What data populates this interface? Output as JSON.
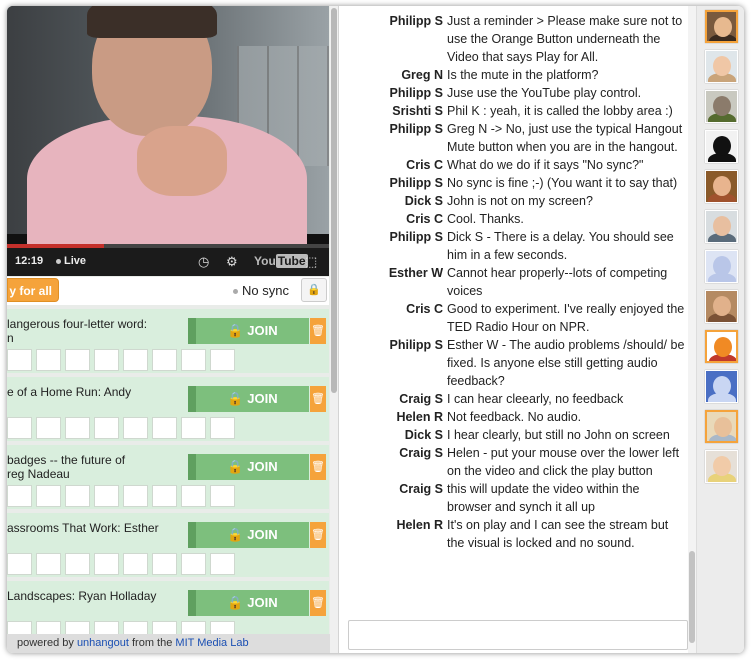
{
  "video": {
    "time": "12:19",
    "live_label": "Live",
    "youtube_text": "You",
    "youtube_tube": "Tube",
    "progress_fraction": 0.3
  },
  "toolbar": {
    "play_all_label": "y for all",
    "no_sync_label": "No sync"
  },
  "sessions": [
    {
      "title": "langerous four-letter word:\nn",
      "join_label": "JOIN",
      "slots": 8
    },
    {
      "title": "e of a Home Run: Andy",
      "join_label": "JOIN",
      "slots": 8
    },
    {
      "title": "badges -- the future of\nreg Nadeau",
      "join_label": "JOIN",
      "slots": 8
    },
    {
      "title": "assrooms That Work: Esther",
      "join_label": "JOIN",
      "slots": 8
    },
    {
      "title": "Landscapes: Ryan Holladay",
      "join_label": "JOIN",
      "slots": 8
    }
  ],
  "footer": {
    "prefix": "powered by ",
    "link1": "unhangout",
    "middle": " from the ",
    "link2": "MIT Media Lab"
  },
  "chat": {
    "messages": [
      {
        "author": "Philipp S",
        "text": "Just a reminder > Please make sure not to use the Orange Button underneath the Video that says Play for All."
      },
      {
        "author": "Greg N",
        "text": "Is the mute in the platform?"
      },
      {
        "author": "Philipp S",
        "text": "Juse use the YouTube play control."
      },
      {
        "author": "Srishti S",
        "text": "Phil K : yeah, it is called the lobby area :)"
      },
      {
        "author": "Philipp S",
        "text": "Greg N -> No, just use the typical Hangout Mute button when you are in the hangout."
      },
      {
        "author": "Cris C",
        "text": "What do we do if it says \"No sync?\""
      },
      {
        "author": "Philipp S",
        "text": "No sync is fine ;-) (You want it to say that)"
      },
      {
        "author": "Dick S",
        "text": "John is not on my screen?"
      },
      {
        "author": "Cris C",
        "text": "Cool. Thanks."
      },
      {
        "author": "Philipp S",
        "text": "Dick S - There is a delay. You should see him in a few seconds."
      },
      {
        "author": "Esther W",
        "text": "Cannot hear properly--lots of competing voices"
      },
      {
        "author": "Cris C",
        "text": "Good to experiment. I've really enjoyed the TED Radio Hour on NPR."
      },
      {
        "author": "Philipp S",
        "text": "Esther W - The audio problems /should/ be fixed. Is anyone else still getting audio feedback?"
      },
      {
        "author": "Craig S",
        "text": "I can hear cleearly, no feedback"
      },
      {
        "author": "Helen R",
        "text": "Not feedback. No audio."
      },
      {
        "author": "Dick S",
        "text": "I hear clearly, but still no John on screen"
      },
      {
        "author": "Craig S",
        "text": "Helen - put your mouse over the lower left on the video and click the play button"
      },
      {
        "author": "Craig S",
        "text": "this will update the video within the browser and synch it all up"
      },
      {
        "author": "Helen R",
        "text": "It's on play and I can see the stream but the visual is locked and no sound."
      }
    ],
    "input_value": "",
    "input_placeholder": ""
  },
  "avatars": [
    {
      "name": "avatar-1",
      "bg": "#7a5a3e",
      "face": "#e7b98f",
      "body": "#3a2a1f",
      "selected": true
    },
    {
      "name": "avatar-2",
      "bg": "#dfe6ea",
      "face": "#f0c7a6",
      "body": "#c9a47a",
      "selected": false
    },
    {
      "name": "avatar-3",
      "bg": "#c9c9c0",
      "face": "#8b7b6b",
      "body": "#556b2f",
      "selected": false
    },
    {
      "name": "avatar-4",
      "bg": "#f2f2f2",
      "face": "#111111",
      "body": "#111111",
      "selected": false
    },
    {
      "name": "avatar-5",
      "bg": "#8a5a2a",
      "face": "#e8b48e",
      "body": "#a0522d",
      "selected": false
    },
    {
      "name": "avatar-6",
      "bg": "#d8dde0",
      "face": "#e8bfa0",
      "body": "#5a6b7a",
      "selected": false
    },
    {
      "name": "avatar-7",
      "bg": "#dde4f4",
      "face": "#b9c6e8",
      "body": "#b9c6e8",
      "selected": false
    },
    {
      "name": "avatar-8",
      "bg": "#b58a62",
      "face": "#e1b18b",
      "body": "#7b5236",
      "selected": false
    },
    {
      "name": "avatar-9",
      "bg": "#ffffff",
      "face": "#f08a24",
      "body": "#c0392b",
      "selected": true
    },
    {
      "name": "avatar-10",
      "bg": "#4a6fc4",
      "face": "#c9d6f3",
      "body": "#c9d6f3",
      "selected": false
    },
    {
      "name": "avatar-11",
      "bg": "#e9d9b9",
      "face": "#e8c09a",
      "body": "#a9b8c8",
      "selected": true
    },
    {
      "name": "avatar-12",
      "bg": "#e6e0d8",
      "face": "#f1cba8",
      "body": "#e8d27a",
      "selected": false
    }
  ],
  "colors": {
    "join_green": "#7dbf7d",
    "orange": "#f5a33b",
    "session_bg": "#d9eedd",
    "link_blue": "#1a4fb3"
  }
}
